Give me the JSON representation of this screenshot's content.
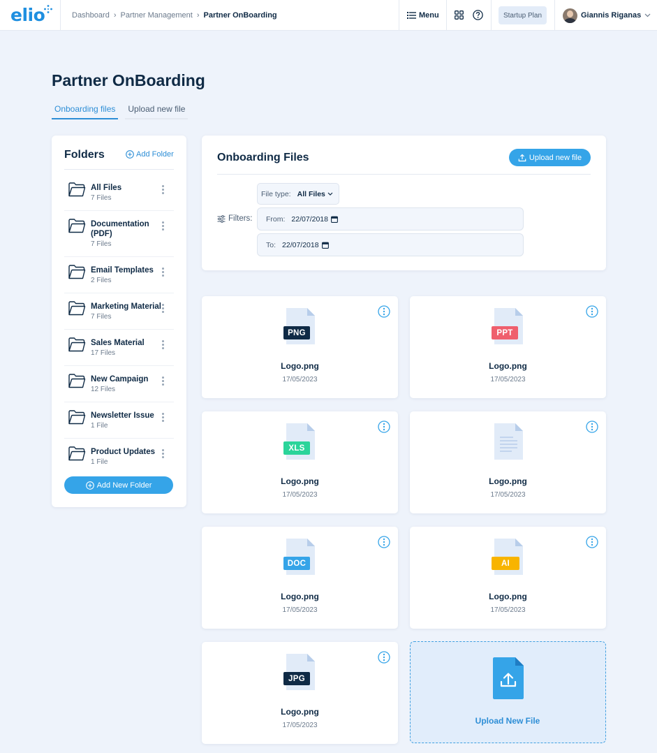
{
  "brand": {
    "logo_text": "elio",
    "accent": "#2d8ed6",
    "button_color": "#35a4e8"
  },
  "breadcrumb": [
    "Dashboard",
    "Partner Management",
    "Partner OnBoarding"
  ],
  "topbar": {
    "menu_label": "Menu",
    "plan_label": "Startup Plan",
    "user_name": "Giannis Riganas"
  },
  "page": {
    "title": "Partner OnBoarding",
    "tabs": [
      {
        "label": "Onboarding files",
        "active": true
      },
      {
        "label": "Upload new file",
        "active": false
      }
    ]
  },
  "folders": {
    "title": "Folders",
    "add_link": "Add Folder",
    "items": [
      {
        "name": "All Files",
        "count": "7 Files"
      },
      {
        "name": "Documentation (PDF)",
        "count": "7 Files"
      },
      {
        "name": "Email Templates",
        "count": "2 Files"
      },
      {
        "name": "Marketing Material",
        "count": "7 Files"
      },
      {
        "name": "Sales Material",
        "count": "17 Files"
      },
      {
        "name": "New Campaign",
        "count": "12 Files"
      },
      {
        "name": "Newsletter Issue",
        "count": "1 File"
      },
      {
        "name": "Product Updates",
        "count": "1 File"
      }
    ],
    "add_button": "Add New Folder"
  },
  "files_panel": {
    "title": "Onboarding Files",
    "upload_button": "Upload new file",
    "filters_label": "Filters:",
    "file_type_label": "File type:",
    "file_type_value": "All Files",
    "from_label": "From:",
    "from_value": "22/07/2018",
    "to_label": "To:",
    "to_value": "22/07/2018"
  },
  "files": [
    {
      "type": "PNG",
      "badge_color": "#0f2a45",
      "name": "Logo.png",
      "date": "17/05/2023"
    },
    {
      "type": "PPT",
      "badge_color": "#ef5f6d",
      "name": "Logo.png",
      "date": "17/05/2023"
    },
    {
      "type": "XLS",
      "badge_color": "#2bd49a",
      "name": "Logo.png",
      "date": "17/05/2023"
    },
    {
      "type": "",
      "badge_color": "",
      "name": "Logo.png",
      "date": "17/05/2023"
    },
    {
      "type": "DOC",
      "badge_color": "#35a4e8",
      "name": "Logo.png",
      "date": "17/05/2023"
    },
    {
      "type": "AI",
      "badge_color": "#f8b400",
      "name": "Logo.png",
      "date": "17/05/2023"
    },
    {
      "type": "JPG",
      "badge_color": "#0f2a45",
      "name": "Logo.png",
      "date": "17/05/2023"
    }
  ],
  "upload_card": {
    "label": "Upload New File"
  }
}
